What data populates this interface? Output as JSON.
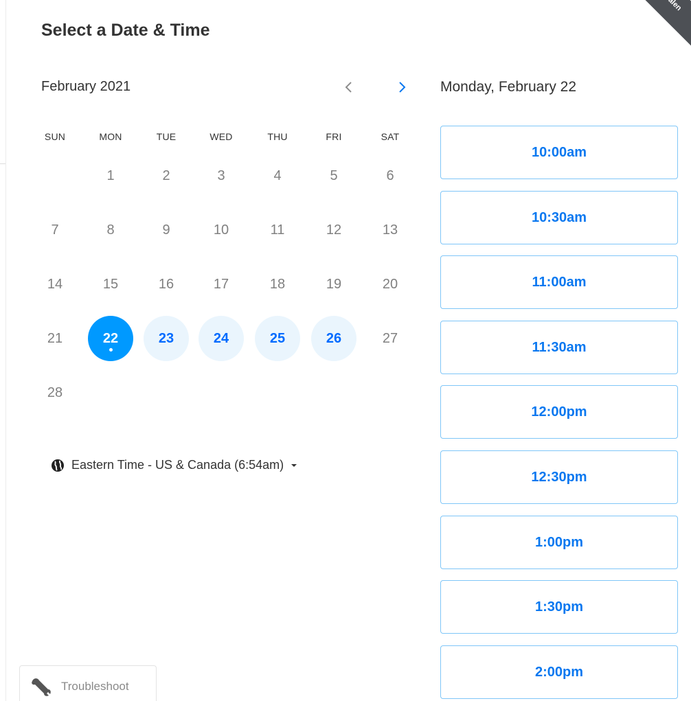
{
  "header": {
    "title": "Select a Date & Time",
    "corner_badge": "Calen"
  },
  "calendar": {
    "month_label": "February 2021",
    "weekdays": [
      "SUN",
      "MON",
      "TUE",
      "WED",
      "THU",
      "FRI",
      "SAT"
    ],
    "days": [
      "1",
      "2",
      "3",
      "4",
      "5",
      "6",
      "7",
      "8",
      "9",
      "10",
      "11",
      "12",
      "13",
      "14",
      "15",
      "16",
      "17",
      "18",
      "19",
      "20",
      "21",
      "22",
      "23",
      "24",
      "25",
      "26",
      "27",
      "28"
    ],
    "selected_day": "22",
    "available_days": [
      "23",
      "24",
      "25",
      "26"
    ]
  },
  "timezone": {
    "label": "Eastern Time - US & Canada (6:54am)"
  },
  "schedule": {
    "date_heading": "Monday, February 22",
    "slots": [
      "10:00am",
      "10:30am",
      "11:00am",
      "11:30am",
      "12:00pm",
      "12:30pm",
      "1:00pm",
      "1:30pm",
      "2:00pm"
    ]
  },
  "footer": {
    "troubleshoot_label": "Troubleshoot"
  },
  "colors": {
    "accent": "#0099ff",
    "available_bg": "#eaf5fd",
    "slot_border": "#7fc6f8",
    "text": "#333333"
  }
}
